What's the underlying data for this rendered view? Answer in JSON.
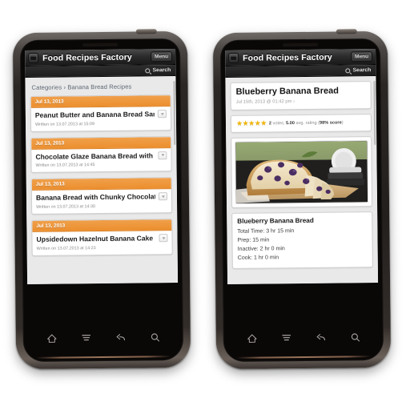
{
  "site": {
    "app_title": "Food Recipes Factory",
    "menu_label": "Menu",
    "search_label": "Search",
    "logo_icon": "app-logo-icon",
    "search_icon": "search-icon",
    "accent_color": "#ec8f2e",
    "appbar_color": "#1a1a1a"
  },
  "left_phone": {
    "breadcrumb": "Categories › Banana Bread Recipes",
    "list": [
      {
        "date": "Jul 13, 2013",
        "title": "Peanut Butter and Banana Bread San..",
        "meta": "Written on 13.07.2013 at 15:09"
      },
      {
        "date": "Jul 13, 2013",
        "title": "Chocolate Glaze Banana Bread with ...",
        "meta": "Written on 13.07.2013 at 14:45"
      },
      {
        "date": "Jul 13, 2013",
        "title": "Banana Bread with Chunky Chocolat...",
        "meta": "Written on 13.07.2013 at 14:30"
      },
      {
        "date": "Jul 13, 2013",
        "title": "Upsidedown Hazelnut Banana Cake",
        "meta": "Written on 13.07.2013 at 14:23"
      }
    ]
  },
  "right_phone": {
    "title": "Blueberry Banana Bread",
    "subtitle": "Jul 15th, 2013 @ 01:42 pm ›",
    "rating": {
      "stars": "★★★★★",
      "votes": "2",
      "votes_word": "votes,",
      "score": "5.00",
      "avg_word": "avg. rating (",
      "percent": "98% score",
      "close_paren": ")"
    },
    "photo_alt": "blueberry-banana-bread-loaf-photo",
    "section_heading": "Blueberry Banana Bread",
    "details": [
      "Total Time: 3 hr 15 min",
      "Prep: 15 min",
      "Inactive: 2 hr 0 min",
      "Cook: 1 hr 0 min"
    ]
  },
  "navbar": {
    "items": [
      {
        "icon": "home-icon",
        "label": "Home"
      },
      {
        "icon": "menu-icon",
        "label": "Menu"
      },
      {
        "icon": "back-icon",
        "label": "Back"
      },
      {
        "icon": "search-icon",
        "label": "Search"
      }
    ]
  }
}
